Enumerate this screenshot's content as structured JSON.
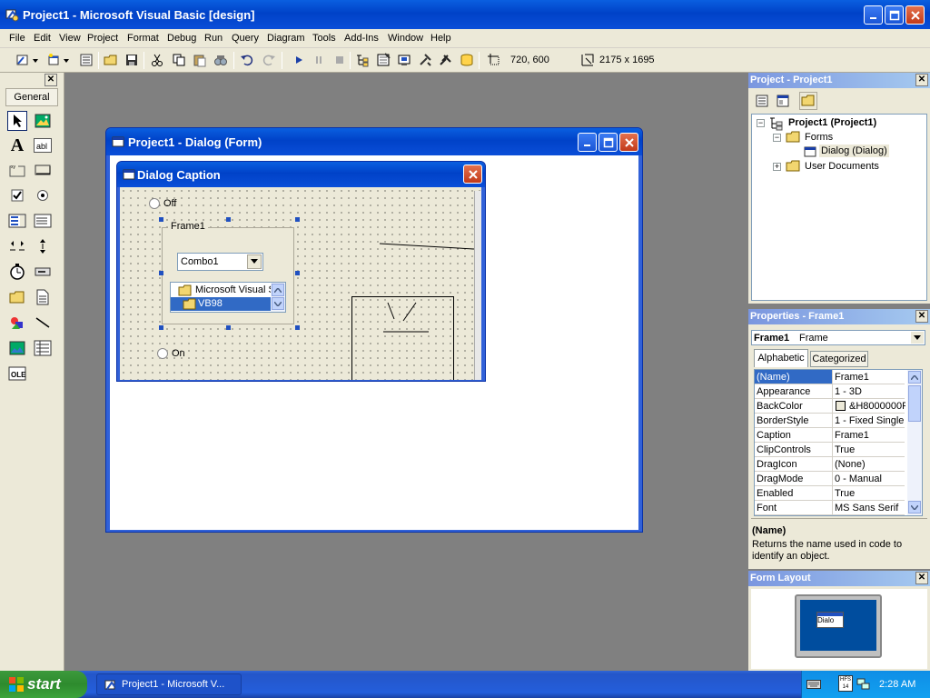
{
  "window": {
    "title": "Project1 - Microsoft Visual Basic [design]"
  },
  "menu": [
    "File",
    "Edit",
    "View",
    "Project",
    "Format",
    "Debug",
    "Run",
    "Query",
    "Diagram",
    "Tools",
    "Add-Ins",
    "Window",
    "Help"
  ],
  "toolbar": {
    "position": "720, 600",
    "size": "2175 x 1695"
  },
  "toolbox": {
    "tab": "General"
  },
  "form_window": {
    "title": "Project1 - Dialog (Form)"
  },
  "dialog": {
    "caption": "Dialog Caption",
    "option_off": "Off",
    "option_on": "On",
    "frame_caption": "Frame1",
    "combo_value": "Combo1",
    "list_items": [
      "Microsoft Visual S",
      "VB98"
    ]
  },
  "project_pane": {
    "title": "Project - Project1",
    "tree": {
      "root": "Project1 (Project1)",
      "forms": "Forms",
      "dialog": "Dialog (Dialog)",
      "user_docs": "User Documents"
    }
  },
  "properties_pane": {
    "title": "Properties - Frame1",
    "object_name": "Frame1",
    "object_type": "Frame",
    "tabs": [
      "Alphabetic",
      "Categorized"
    ],
    "rows": [
      {
        "name": "(Name)",
        "value": "Frame1"
      },
      {
        "name": "Appearance",
        "value": "1 - 3D"
      },
      {
        "name": "BackColor",
        "value": "&H8000000F"
      },
      {
        "name": "BorderStyle",
        "value": "1 - Fixed Single"
      },
      {
        "name": "Caption",
        "value": "Frame1"
      },
      {
        "name": "ClipControls",
        "value": "True"
      },
      {
        "name": "DragIcon",
        "value": "(None)"
      },
      {
        "name": "DragMode",
        "value": "0 - Manual"
      },
      {
        "name": "Enabled",
        "value": "True"
      },
      {
        "name": "Font",
        "value": "MS Sans Serif"
      }
    ],
    "desc_title": "(Name)",
    "desc_text": "Returns the name used in code to identify an object."
  },
  "layout_pane": {
    "title": "Form Layout",
    "mini_label": "Dialo"
  },
  "taskbar": {
    "start": "start",
    "task": "Project1 - Microsoft V...",
    "clock": "2:28 AM",
    "lang": "HFS 14"
  },
  "colors": {
    "xp_blue": "#0a4ed8",
    "face": "#ece9d8",
    "desktop": "#808080",
    "selection": "#316ac5"
  }
}
